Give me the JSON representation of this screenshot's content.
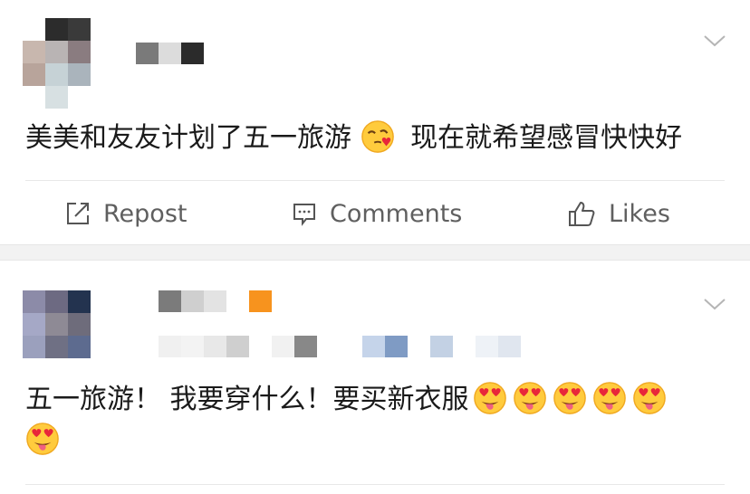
{
  "posts": [
    {
      "content": "美美和友友计划了五一旅游",
      "content_suffix": "现在就希望感冒快快好",
      "emoji_icons": [
        "face-blowing-kiss-icon"
      ],
      "actions": {
        "repost": "Repost",
        "comments": "Comments",
        "likes": "Likes"
      }
    },
    {
      "content": "五一旅游！ 我要穿什么！要买新衣服",
      "emoji_icons": [
        "heart-eyes-face-icon",
        "heart-eyes-face-icon",
        "heart-eyes-face-icon",
        "heart-eyes-face-icon",
        "heart-eyes-face-icon",
        "heart-eyes-face-icon"
      ]
    }
  ],
  "colors": {
    "separator": "#f2f2f2",
    "divider": "#e8e8e8",
    "action_text": "#5f5f5f",
    "badge": "#f7931e"
  }
}
